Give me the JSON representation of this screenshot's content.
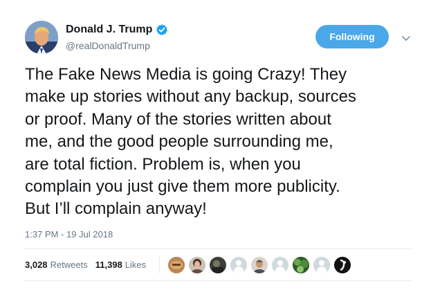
{
  "author": {
    "display_name": "Donald J. Trump",
    "handle": "@realDonaldTrump",
    "verified": true,
    "avatar_icon": "profile-photo",
    "verified_icon": "verified-badge-icon",
    "verified_color": "#1da1f2"
  },
  "actions": {
    "follow_label": "Following",
    "follow_color": "#4aa8e8",
    "menu_icon": "chevron-down-icon"
  },
  "tweet": {
    "text_lines": [
      "The Fake News Media is going Crazy! They",
      "make up stories without any backup, sources",
      "or proof. Many of the stories written about",
      "me, and the good people surrounding me,",
      "are total fiction. Problem is, when you",
      "complain you just give them more publicity.",
      "But I’ll complain anyway!"
    ],
    "timestamp": "1:37 PM - 19 Jul 2018"
  },
  "stats": {
    "retweets_count": "3,028",
    "retweets_label": "Retweets",
    "likes_count": "11,398",
    "likes_label": "Likes"
  },
  "likers": [
    {
      "icon": "liker-avatar-brown-badge"
    },
    {
      "icon": "liker-avatar-woman"
    },
    {
      "icon": "liker-avatar-dark-photo"
    },
    {
      "icon": "liker-avatar-default"
    },
    {
      "icon": "liker-avatar-man"
    },
    {
      "icon": "liker-avatar-default"
    },
    {
      "icon": "liker-avatar-green-leaves"
    },
    {
      "icon": "liker-avatar-default"
    },
    {
      "icon": "liker-avatar-black-white"
    }
  ]
}
